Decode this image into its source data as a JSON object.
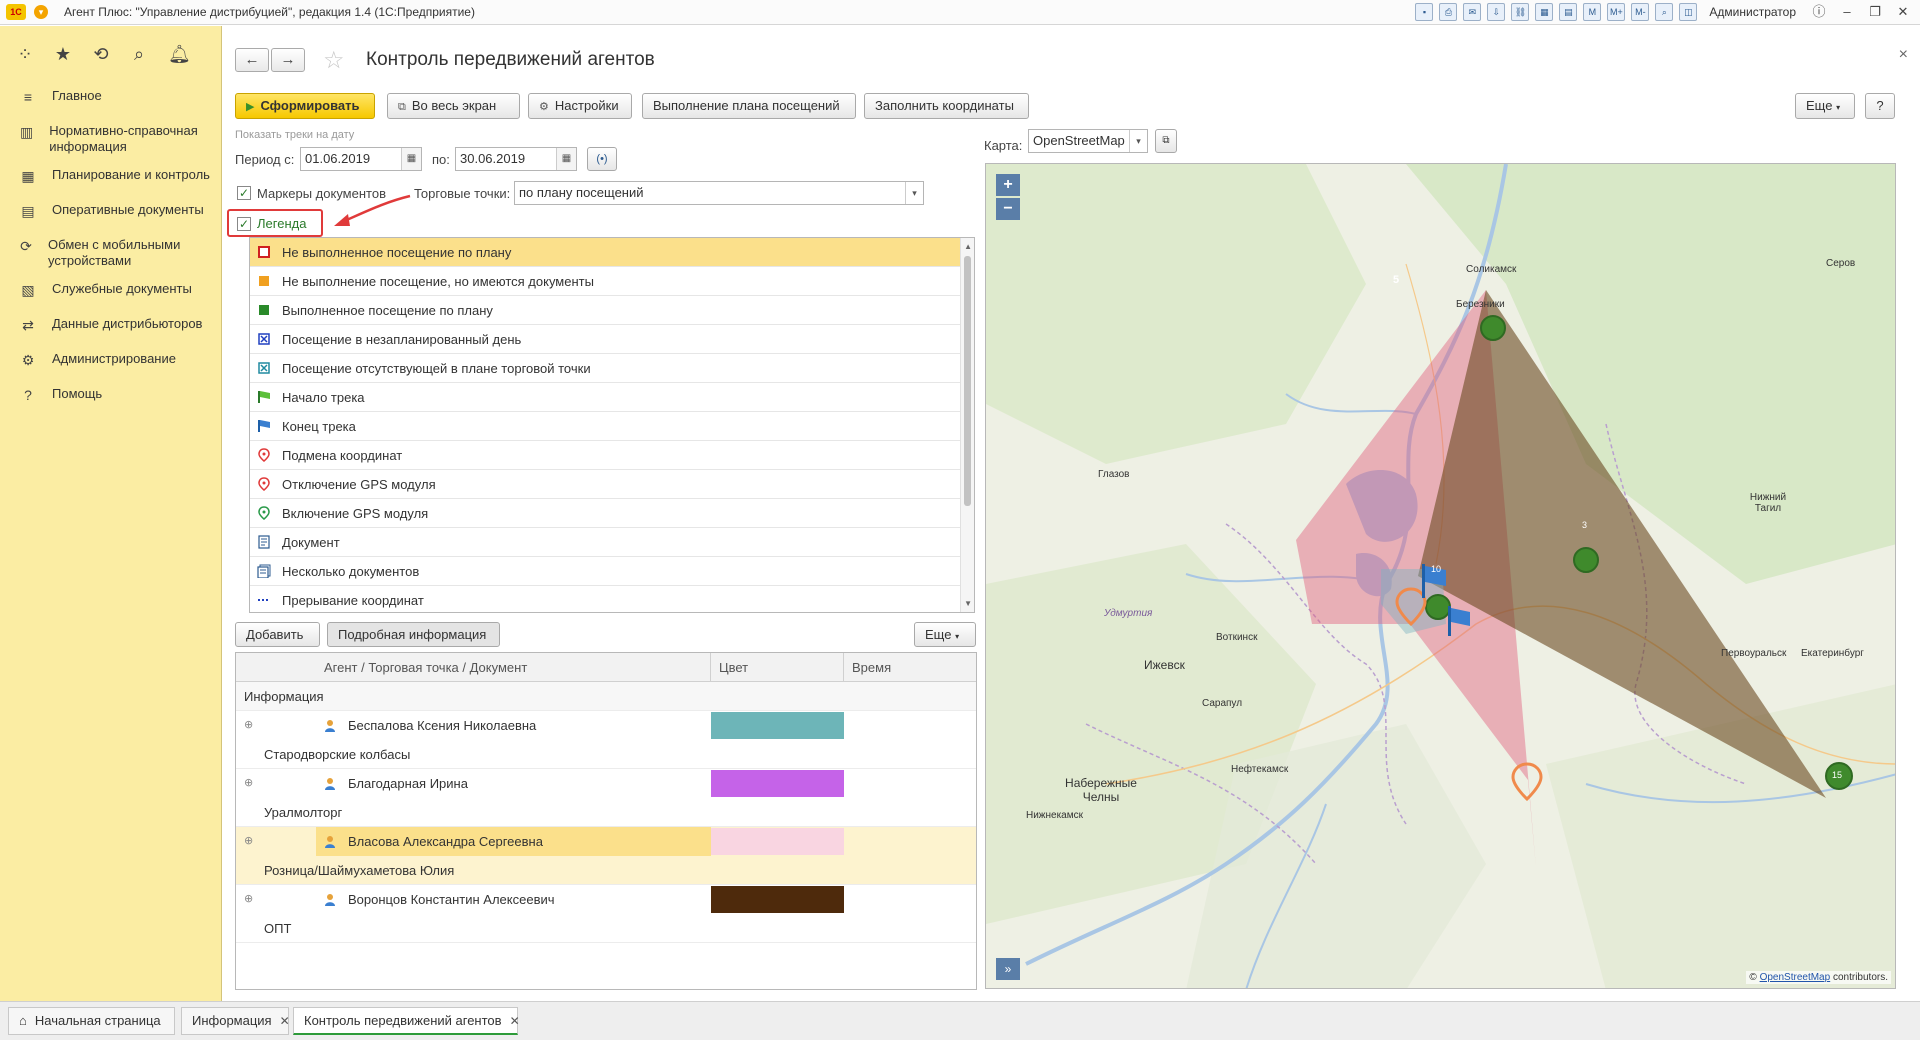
{
  "window": {
    "title": "Агент Плюс: \"Управление дистрибуцией\", редакция 1.4  (1С:Предприятие)",
    "logo": "1С",
    "user": "Администратор"
  },
  "sidebar": {
    "items": [
      {
        "label": "Главное",
        "icon": "menu-lines-icon"
      },
      {
        "label": "Нормативно-справочная информация",
        "icon": "bars-chart-icon"
      },
      {
        "label": "Планирование и контроль",
        "icon": "chart-icon"
      },
      {
        "label": "Оперативные документы",
        "icon": "document-icon"
      },
      {
        "label": "Обмен с мобильными устройствами",
        "icon": "sync-icon"
      },
      {
        "label": "Служебные документы",
        "icon": "docs-icon"
      },
      {
        "label": "Данные дистрибьюторов",
        "icon": "exchange-icon"
      },
      {
        "label": "Администрирование",
        "icon": "gear-icon"
      },
      {
        "label": "Помощь",
        "icon": "question-icon"
      }
    ]
  },
  "header": {
    "title": "Контроль передвижений агентов"
  },
  "toolbar": {
    "generate": "Сформировать",
    "fullscreen": "Во весь экран",
    "settings": "Настройки",
    "plan": "Выполнение плана посещений",
    "fill_coords": "Заполнить координаты",
    "more": "Еще",
    "help": "?"
  },
  "filters": {
    "tracks_caption": "Показать треки на дату",
    "period_label": "Период с:",
    "date_from": "01.06.2019",
    "to_label": "по:",
    "date_to": "30.06.2019",
    "markers_label": "Маркеры документов",
    "points_label": "Торговые точки:",
    "points_value": "по плану посещений",
    "legend_label": "Легенда"
  },
  "legend": [
    {
      "label": "Не выполненное посещение по плану",
      "icon": "red-square-icon"
    },
    {
      "label": "Не выполнение посещение, но имеются документы",
      "icon": "orange-square-icon"
    },
    {
      "label": "Выполненное посещение по плану",
      "icon": "green-square-icon"
    },
    {
      "label": "Посещение в незапланированный день",
      "icon": "blue-x-icon"
    },
    {
      "label": "Посещение отсутствующей в плане торговой точки",
      "icon": "teal-x-icon"
    },
    {
      "label": "Начало трека",
      "icon": "green-flag-icon"
    },
    {
      "label": "Конец трека",
      "icon": "blue-flag-icon"
    },
    {
      "label": "Подмена координат",
      "icon": "pin-red-icon"
    },
    {
      "label": "Отключение GPS модуля",
      "icon": "pin-red-icon"
    },
    {
      "label": "Включение GPS модуля",
      "icon": "pin-green-icon"
    },
    {
      "label": "Документ",
      "icon": "document-icon"
    },
    {
      "label": "Несколько документов",
      "icon": "documents-icon"
    },
    {
      "label": "Прерывание координат",
      "icon": "dotted-line-icon"
    }
  ],
  "table_toolbar": {
    "add": "Добавить",
    "details": "Подробная информация",
    "more": "Еще"
  },
  "table": {
    "columns": [
      "Агент / Торговая точка / Документ",
      "Цвет",
      "Время"
    ],
    "group": "Информация",
    "rows": [
      {
        "agent": "Беспалова Ксения Николаевна",
        "point": "Стародворские колбасы",
        "color": "#6db5b8"
      },
      {
        "agent": "Благодарная Ирина",
        "point": "Уралмолторг",
        "color": "#c563e8"
      },
      {
        "agent": "Власова Александра Сергеевна",
        "point": "Розница/Шаймухаметова Юлия",
        "color": "#f9d5e1"
      },
      {
        "agent": "Воронцов Константин Алексеевич",
        "point": "ОПТ",
        "color": "#4e2a0c"
      }
    ]
  },
  "map": {
    "label": "Карта:",
    "provider": "OpenStreetMap",
    "zoom_in": "+",
    "zoom_out": "−",
    "expand": "»",
    "attribution_prefix": "©",
    "attribution_link": "OpenStreetMap",
    "attribution_suffix": "contributors.",
    "cities": [
      {
        "name": "Соликамск",
        "key": "solikamsk"
      },
      {
        "name": "Березники",
        "key": "berezniki"
      },
      {
        "name": "Серов",
        "key": "serov"
      },
      {
        "name": "Глазов",
        "key": "glazov"
      },
      {
        "name": "Нижний Тагил",
        "key": "ntagil"
      },
      {
        "name": "Удмуртия",
        "key": "udm"
      },
      {
        "name": "Воткинск",
        "key": "votkinsk"
      },
      {
        "name": "Ижевск",
        "key": "izhevsk"
      },
      {
        "name": "Сарапул",
        "key": "sarapul"
      },
      {
        "name": "Первоуральск",
        "key": "pervouralsk"
      },
      {
        "name": "Екатеринбург",
        "key": "ekb"
      },
      {
        "name": "Нефтекамск",
        "key": "neftekamsk"
      },
      {
        "name": "Набережные Челны",
        "key": "chelny"
      },
      {
        "name": "Нижнекамск",
        "key": "nizhnekamsk"
      }
    ],
    "clusters": [
      "5",
      "3",
      "10",
      "15"
    ],
    "colors": {
      "pink": "#e0607e",
      "brown": "#6b4a22",
      "green": "#3f8a2c",
      "water": "#a9c6e4"
    }
  },
  "tabs": [
    {
      "label": "Начальная страница",
      "closable": false
    },
    {
      "label": "Информация",
      "closable": true
    },
    {
      "label": "Контроль передвижений агентов",
      "closable": true
    }
  ]
}
